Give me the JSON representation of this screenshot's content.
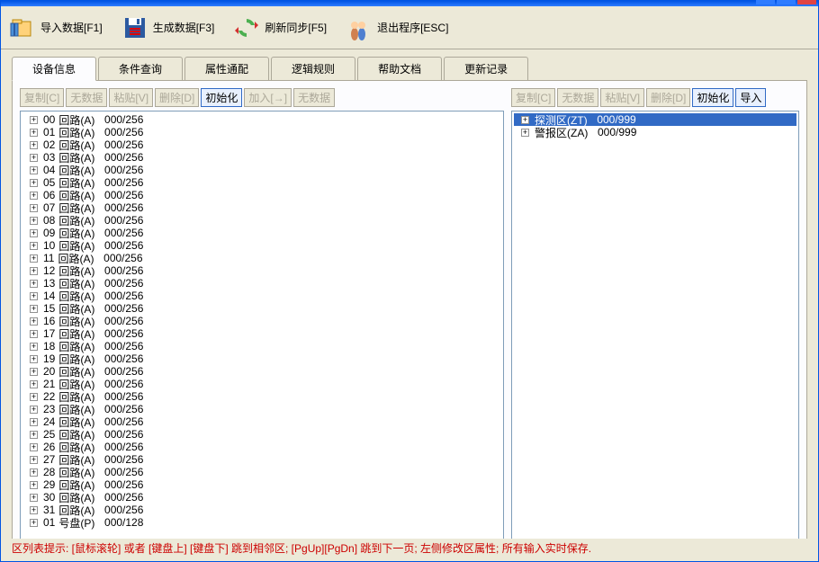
{
  "toolbar": [
    {
      "label": "导入数据[F1]",
      "icon": "import"
    },
    {
      "label": "生成数据[F3]",
      "icon": "save"
    },
    {
      "label": "刷新同步[F5]",
      "icon": "refresh"
    },
    {
      "label": "退出程序[ESC]",
      "icon": "exit"
    }
  ],
  "tabs": [
    {
      "label": "设备信息",
      "active": true
    },
    {
      "label": "条件查询"
    },
    {
      "label": "属性通配"
    },
    {
      "label": "逻辑规则"
    },
    {
      "label": "帮助文档"
    },
    {
      "label": "更新记录"
    }
  ],
  "left_buttons": [
    {
      "label": "复制[C]",
      "state": "disabled"
    },
    {
      "label": "无数据",
      "state": "disabled"
    },
    {
      "label": "粘贴[V]",
      "state": "disabled"
    },
    {
      "label": "删除[D]",
      "state": "disabled"
    },
    {
      "label": "初始化",
      "state": "active"
    },
    {
      "label": "加入[→]",
      "state": "disabled"
    },
    {
      "label": "无数据",
      "state": "disabled"
    }
  ],
  "right_buttons": [
    {
      "label": "复制[C]",
      "state": "disabled"
    },
    {
      "label": "无数据",
      "state": "disabled"
    },
    {
      "label": "粘贴[V]",
      "state": "disabled"
    },
    {
      "label": "删除[D]",
      "state": "disabled"
    },
    {
      "label": "初始化",
      "state": "active"
    },
    {
      "label": "导入",
      "state": "active"
    }
  ],
  "left_tree": [
    {
      "idx": "00",
      "name": "回路(A)",
      "count": "000/256"
    },
    {
      "idx": "01",
      "name": "回路(A)",
      "count": "000/256"
    },
    {
      "idx": "02",
      "name": "回路(A)",
      "count": "000/256"
    },
    {
      "idx": "03",
      "name": "回路(A)",
      "count": "000/256"
    },
    {
      "idx": "04",
      "name": "回路(A)",
      "count": "000/256"
    },
    {
      "idx": "05",
      "name": "回路(A)",
      "count": "000/256"
    },
    {
      "idx": "06",
      "name": "回路(A)",
      "count": "000/256"
    },
    {
      "idx": "07",
      "name": "回路(A)",
      "count": "000/256"
    },
    {
      "idx": "08",
      "name": "回路(A)",
      "count": "000/256"
    },
    {
      "idx": "09",
      "name": "回路(A)",
      "count": "000/256"
    },
    {
      "idx": "10",
      "name": "回路(A)",
      "count": "000/256"
    },
    {
      "idx": "11",
      "name": "回路(A)",
      "count": "000/256"
    },
    {
      "idx": "12",
      "name": "回路(A)",
      "count": "000/256"
    },
    {
      "idx": "13",
      "name": "回路(A)",
      "count": "000/256"
    },
    {
      "idx": "14",
      "name": "回路(A)",
      "count": "000/256"
    },
    {
      "idx": "15",
      "name": "回路(A)",
      "count": "000/256"
    },
    {
      "idx": "16",
      "name": "回路(A)",
      "count": "000/256"
    },
    {
      "idx": "17",
      "name": "回路(A)",
      "count": "000/256"
    },
    {
      "idx": "18",
      "name": "回路(A)",
      "count": "000/256"
    },
    {
      "idx": "19",
      "name": "回路(A)",
      "count": "000/256"
    },
    {
      "idx": "20",
      "name": "回路(A)",
      "count": "000/256"
    },
    {
      "idx": "21",
      "name": "回路(A)",
      "count": "000/256"
    },
    {
      "idx": "22",
      "name": "回路(A)",
      "count": "000/256"
    },
    {
      "idx": "23",
      "name": "回路(A)",
      "count": "000/256"
    },
    {
      "idx": "24",
      "name": "回路(A)",
      "count": "000/256"
    },
    {
      "idx": "25",
      "name": "回路(A)",
      "count": "000/256"
    },
    {
      "idx": "26",
      "name": "回路(A)",
      "count": "000/256"
    },
    {
      "idx": "27",
      "name": "回路(A)",
      "count": "000/256"
    },
    {
      "idx": "28",
      "name": "回路(A)",
      "count": "000/256"
    },
    {
      "idx": "29",
      "name": "回路(A)",
      "count": "000/256"
    },
    {
      "idx": "30",
      "name": "回路(A)",
      "count": "000/256"
    },
    {
      "idx": "31",
      "name": "回路(A)",
      "count": "000/256"
    },
    {
      "idx": "01",
      "name": "号盘(P)",
      "count": "000/128"
    }
  ],
  "right_tree": [
    {
      "name": "探测区(ZT)",
      "count": "000/999",
      "selected": true
    },
    {
      "name": "警报区(ZA)",
      "count": "000/999"
    }
  ],
  "footer": "区列表提示: [鼠标滚轮] 或者 [键盘上] [键盘下] 跳到相邻区; [PgUp][PgDn] 跳到下一页; 左侧修改区属性; 所有输入实时保存."
}
